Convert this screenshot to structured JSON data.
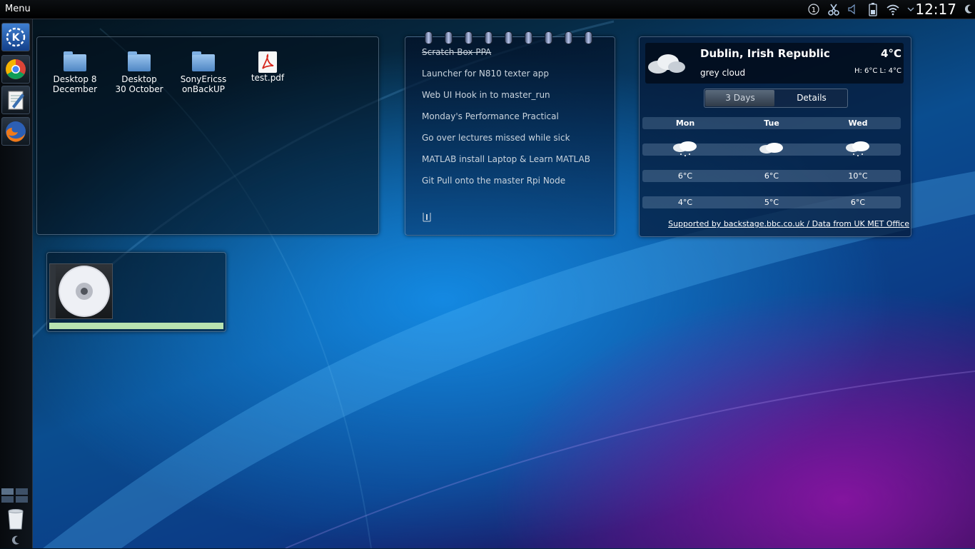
{
  "top_panel": {
    "menu_label": "Menu",
    "clock": "12:17",
    "tray_badge": "1"
  },
  "desktop_folder": {
    "items": [
      {
        "label": "Desktop 8 December",
        "line1": "Desktop 8",
        "line2": "December",
        "icon": "folder-icon"
      },
      {
        "label": "Desktop 30 October",
        "line1": "Desktop",
        "line2": "30 October",
        "icon": "folder-icon"
      },
      {
        "label": "SonyEricssonBackUP",
        "line1": "SonyEricss",
        "line2": "onBackUP",
        "icon": "folder-icon"
      },
      {
        "label": "test.pdf",
        "line1": "test.pdf",
        "line2": "",
        "icon": "pdf-icon"
      }
    ]
  },
  "notes": {
    "items": [
      {
        "text": "Scratch Box PPA",
        "done": true
      },
      {
        "text": "Launcher for N810 texter app",
        "done": false
      },
      {
        "text": "Web UI Hook in to master_run",
        "done": false
      },
      {
        "text": "Monday's Performance Practical",
        "done": false
      },
      {
        "text": "Go over lectures missed while sick",
        "done": false
      },
      {
        "text": "MATLAB install Laptop & Learn MATLAB",
        "done": false
      },
      {
        "text": "Git Pull onto the master Rpi Node",
        "done": false
      }
    ]
  },
  "weather": {
    "location": "Dublin, Irish Republic",
    "current_temp": "4°C",
    "condition": "grey cloud",
    "hilo": "H: 6°C L: 4°C",
    "tabs": [
      "3 Days",
      "Details"
    ],
    "active_tab": "3 Days",
    "days": [
      {
        "name": "Mon",
        "high": "6°C",
        "low": "4°C",
        "icon": "snow-cloud-icon"
      },
      {
        "name": "Tue",
        "high": "6°C",
        "low": "5°C",
        "icon": "cloud-icon"
      },
      {
        "name": "Wed",
        "high": "10°C",
        "low": "6°C",
        "icon": "snow-cloud-icon"
      }
    ],
    "credit": "Supported by backstage.bbc.co.uk / Data from UK MET Office"
  },
  "media_player": {
    "progress": 1.0
  },
  "colors": {
    "progress_fill": "#b8e3b0",
    "panel_border": "#a9c3de",
    "wallpaper_blue": "#0a6ad0",
    "wallpaper_purple": "#8a16a8"
  }
}
